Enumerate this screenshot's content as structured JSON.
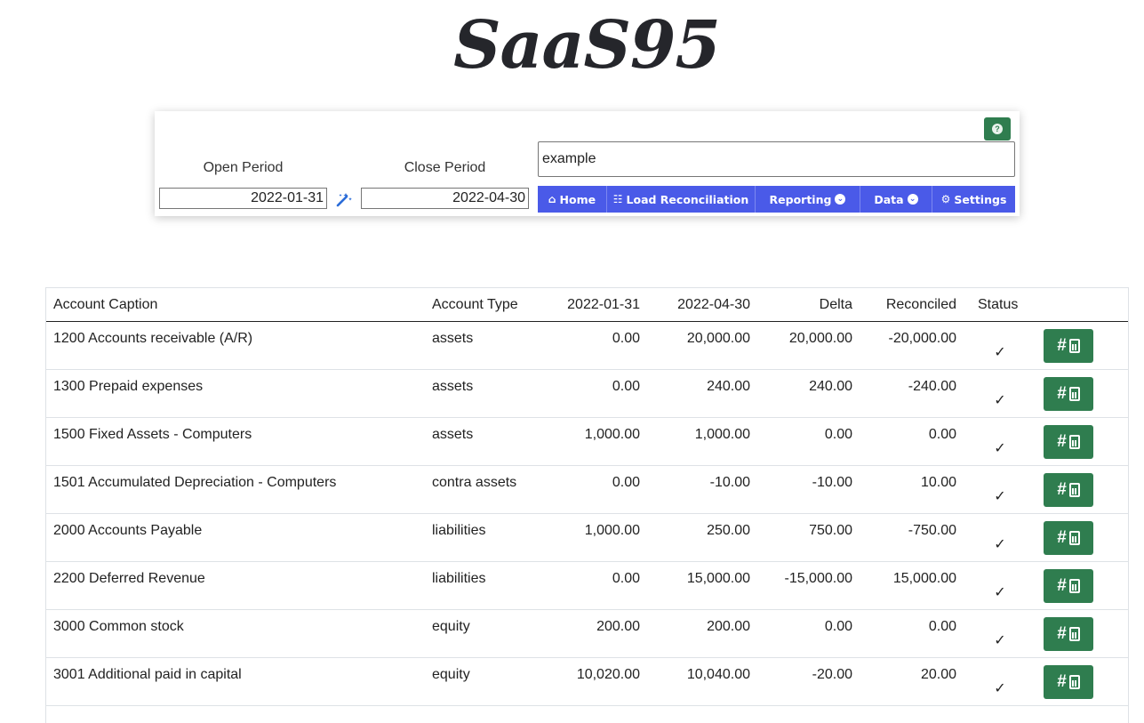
{
  "brand": {
    "logo": "SaaS95"
  },
  "controls": {
    "open_period_label": "Open Period",
    "close_period_label": "Close Period",
    "open_period_value": "2022-01-31",
    "close_period_value": "2022-04-30",
    "search_value": "example",
    "help_icon": "question-circle-icon",
    "wand_icon": "magic-wand-icon",
    "help_glyph": "?"
  },
  "nav": {
    "home": "Home",
    "load_reconciliation": "Load Reconciliation",
    "reporting": "Reporting",
    "data": "Data",
    "settings": "Settings"
  },
  "table": {
    "headers": [
      "Account Caption",
      "Account Type",
      "2022-01-31",
      "2022-04-30",
      "Delta",
      "Reconciled",
      "Status"
    ],
    "rows": [
      [
        "1200 Accounts receivable (A/R)",
        "assets",
        "0.00",
        "20,000.00",
        "20,000.00",
        "-20,000.00"
      ],
      [
        "1300 Prepaid expenses",
        "assets",
        "0.00",
        "240.00",
        "240.00",
        "-240.00"
      ],
      [
        "1500 Fixed Assets - Computers",
        "assets",
        "1,000.00",
        "1,000.00",
        "0.00",
        "0.00"
      ],
      [
        "1501 Accumulated Depreciation - Computers",
        "contra assets",
        "0.00",
        "-10.00",
        "-10.00",
        "10.00"
      ],
      [
        "2000 Accounts Payable",
        "liabilities",
        "1,000.00",
        "250.00",
        "750.00",
        "-750.00"
      ],
      [
        "2200 Deferred Revenue",
        "liabilities",
        "0.00",
        "15,000.00",
        "-15,000.00",
        "15,000.00"
      ],
      [
        "3000 Common stock",
        "equity",
        "200.00",
        "200.00",
        "0.00",
        "0.00"
      ],
      [
        "3001 Additional paid in capital",
        "equity",
        "10,020.00",
        "10,040.00",
        "-20.00",
        "20.00"
      ]
    ],
    "status_glyph": "✓",
    "action_glyph": "#"
  },
  "colors": {
    "accent": "#4a5ae8",
    "success": "#2f7d4f"
  }
}
